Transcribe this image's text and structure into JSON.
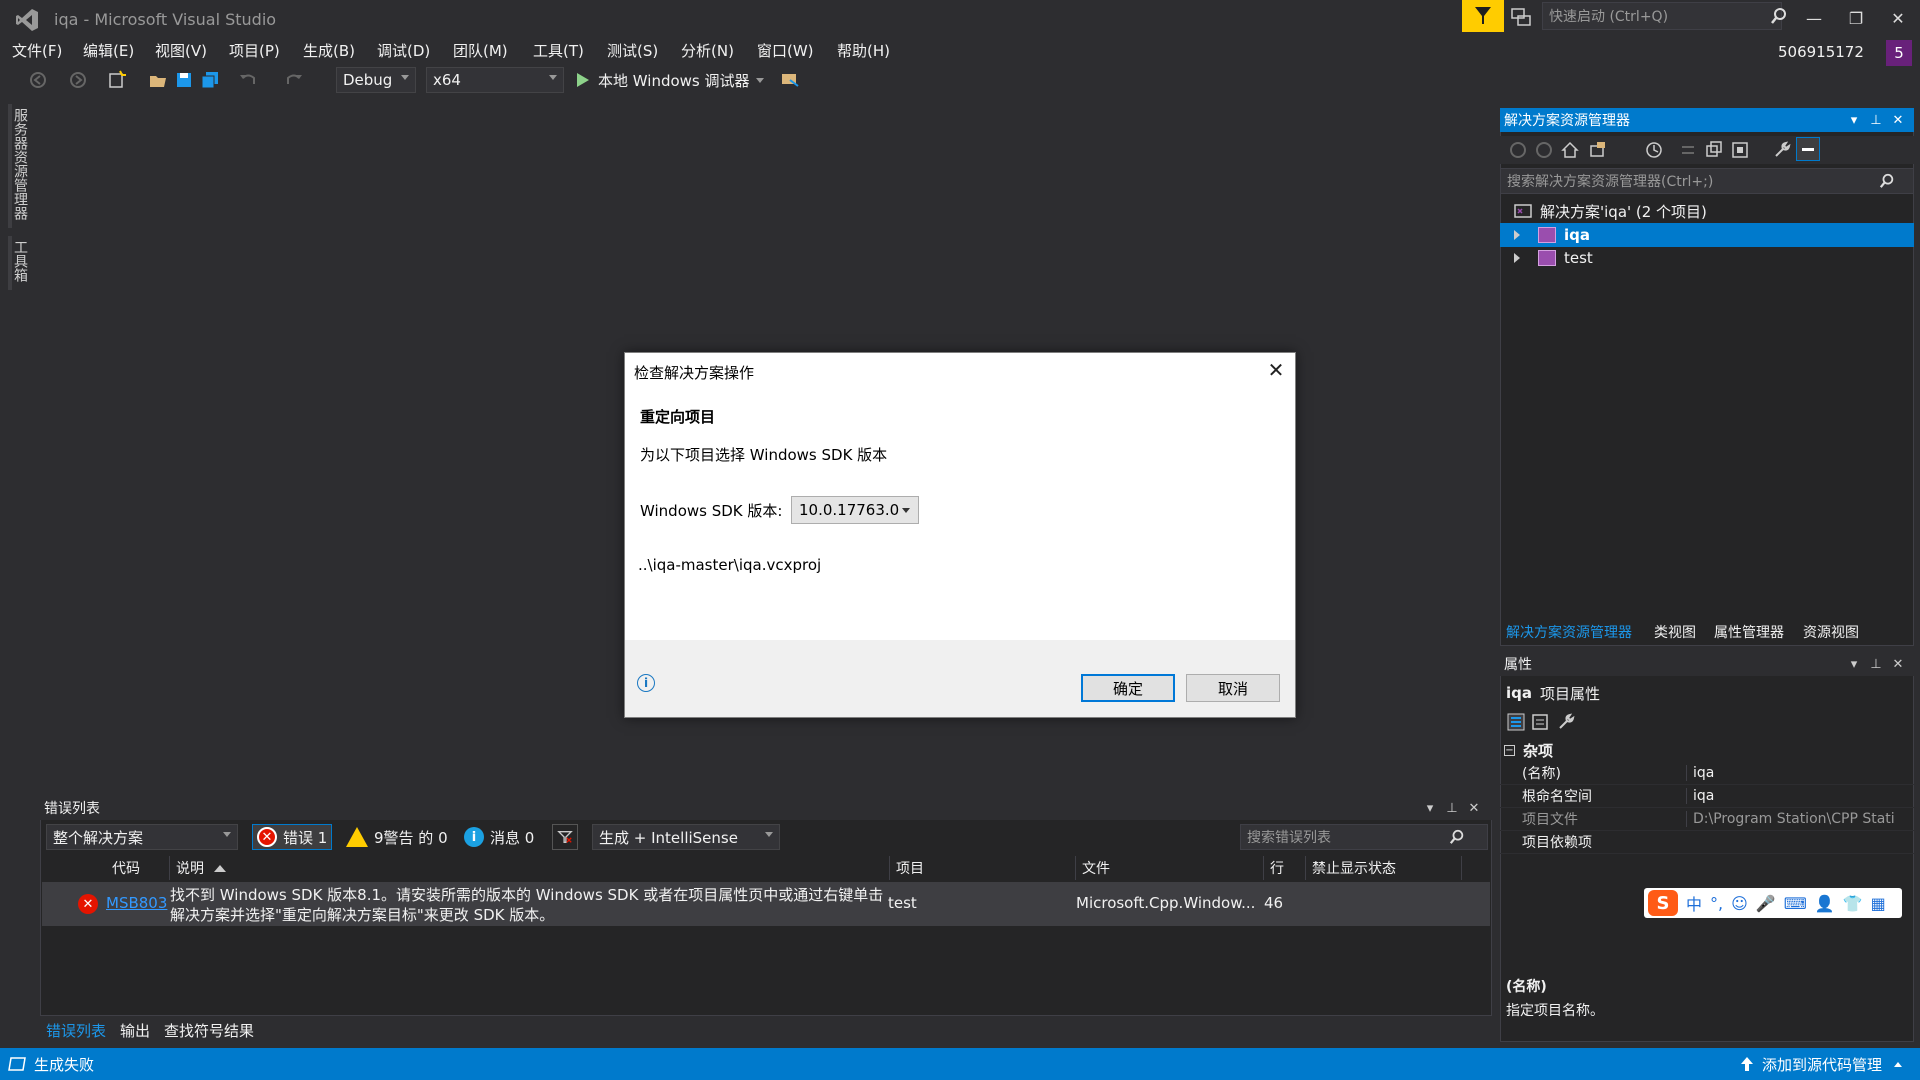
{
  "window": {
    "title": "iqa - Microsoft Visual Studio",
    "quick_launch_placeholder": "快速启动 (Ctrl+Q)",
    "minimize": "—",
    "restore": "❐",
    "close": "✕",
    "user": "506915172",
    "avatar": "5"
  },
  "menu": [
    "文件(F)",
    "编辑(E)",
    "视图(V)",
    "项目(P)",
    "生成(B)",
    "调试(D)",
    "团队(M)",
    "工具(T)",
    "测试(S)",
    "分析(N)",
    "窗口(W)",
    "帮助(H)"
  ],
  "toolbar": {
    "configuration": "Debug",
    "platform": "x64",
    "debugger": "本地 Windows 调试器"
  },
  "left_tabs": [
    "服务器资源管理器",
    "工具箱"
  ],
  "solution_explorer": {
    "title": "解决方案资源管理器",
    "search_placeholder": "搜索解决方案资源管理器(Ctrl+;)",
    "solution": "解决方案'iqa' (2 个项目)",
    "projects": [
      {
        "name": "iqa",
        "selected": true
      },
      {
        "name": "test",
        "selected": false
      }
    ],
    "tabs": [
      "解决方案资源管理器",
      "类视图",
      "属性管理器",
      "资源视图"
    ]
  },
  "properties": {
    "title": "属性",
    "object": "iqa",
    "object_suffix": "项目属性",
    "category": "杂项",
    "rows": [
      {
        "name": "(名称)",
        "value": "iqa"
      },
      {
        "name": "根命名空间",
        "value": "iqa"
      },
      {
        "name": "项目文件",
        "value": "D:\\Program Station\\CPP Stati"
      },
      {
        "name": "项目依赖项",
        "value": ""
      }
    ],
    "desc_title": "(名称)",
    "desc_text": "指定项目名称。"
  },
  "ime": {
    "logo": "S",
    "items": [
      "中",
      "°,",
      "☺",
      "🎤",
      "⌨",
      "👤",
      "👕",
      "▦"
    ]
  },
  "error_list": {
    "title": "错误列表",
    "scope": "整个解决方案",
    "errors": "错误 1",
    "warnings": "9警告 的 0",
    "messages": "消息 0",
    "source": "生成 + IntelliSense",
    "search_placeholder": "搜索错误列表",
    "columns": [
      "代码",
      "说明",
      "项目",
      "文件",
      "行",
      "禁止显示状态"
    ],
    "rows": [
      {
        "code": "MSB803",
        "description_line1": "找不到 Windows SDK 版本8.1。请安装所需的版本的 Windows SDK 或者在项目属性页中或通过右键单击",
        "description_line2": "解决方案并选择\"重定向解决方案目标\"来更改 SDK 版本。",
        "project": "test",
        "file": "Microsoft.Cpp.Window...",
        "line": "46"
      }
    ],
    "bottom_tabs": [
      "错误列表",
      "输出",
      "查找符号结果"
    ]
  },
  "status": {
    "text": "生成失败",
    "source_control": "添加到源代码管理"
  },
  "dialog": {
    "title": "检查解决方案操作",
    "heading": "重定向项目",
    "instruction": "为以下项目选择 Windows SDK 版本",
    "sdk_label": "Windows SDK 版本:",
    "sdk_value": "10.0.17763.0",
    "project_path": "..\\iqa-master\\iqa.vcxproj",
    "ok": "确定",
    "cancel": "取消"
  }
}
